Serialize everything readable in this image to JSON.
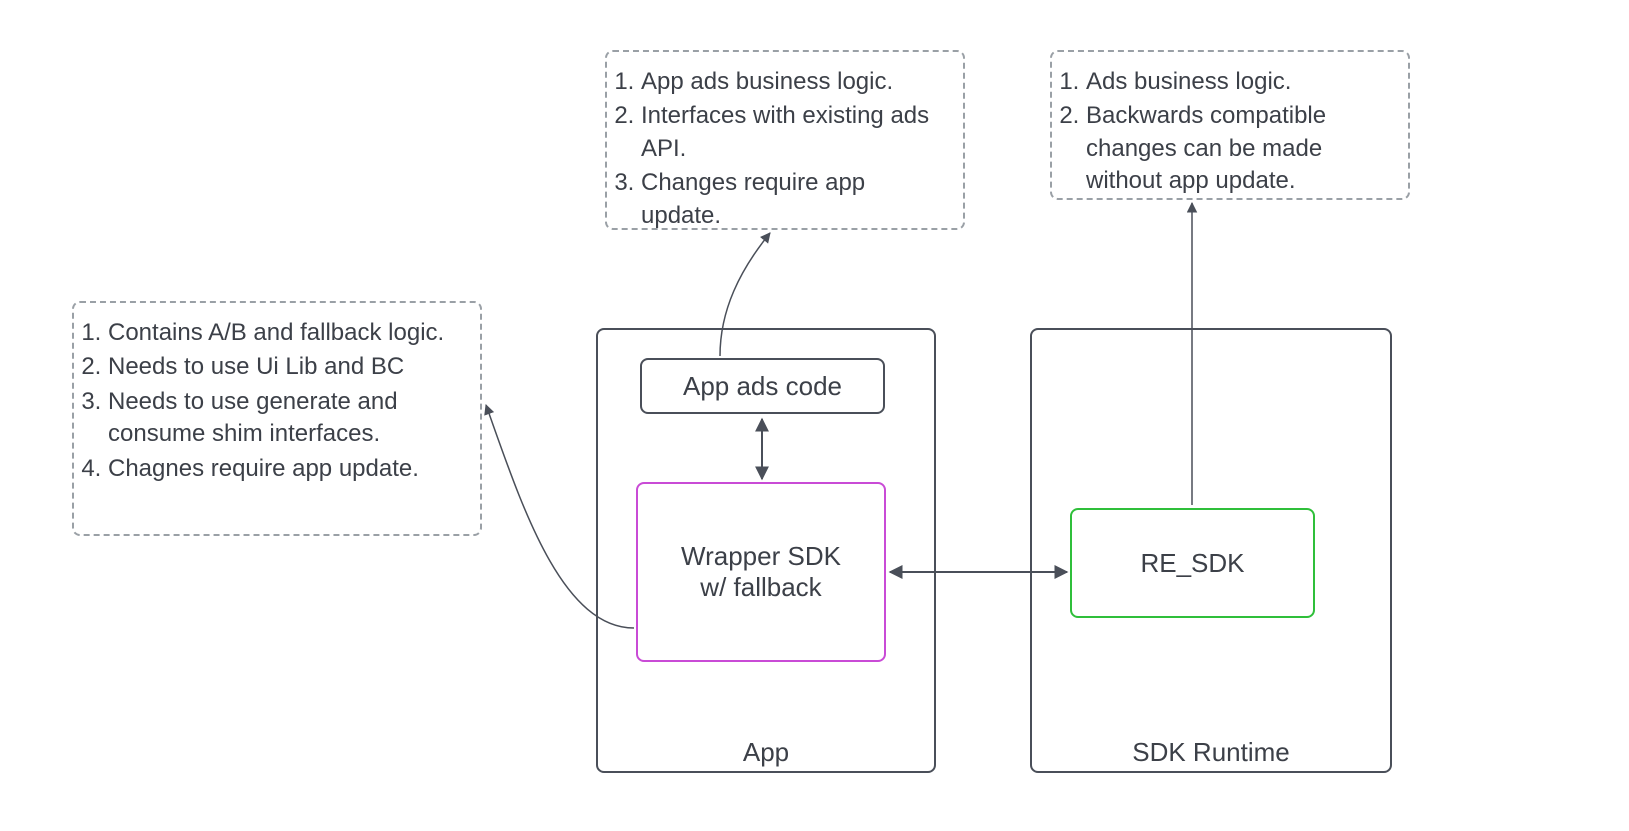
{
  "notes": {
    "left": {
      "items": [
        "Contains A/B and fallback logic.",
        "Needs to use Ui Lib and BC",
        "Needs to use generate and consume shim interfaces.",
        "Chagnes require app update."
      ]
    },
    "top_center": {
      "items": [
        "App ads business logic.",
        "Interfaces with existing ads API.",
        "Changes require app update."
      ]
    },
    "top_right": {
      "items": [
        "Ads business logic.",
        "Backwards compatible changes can be made without app update."
      ]
    }
  },
  "containers": {
    "app": {
      "title": "App"
    },
    "sdk_runtime": {
      "title": "SDK Runtime"
    }
  },
  "nodes": {
    "app_ads_code": {
      "label": "App ads code"
    },
    "wrapper_sdk": {
      "line1": "Wrapper SDK",
      "line2": "w/ fallback"
    },
    "re_sdk": {
      "label": "RE_SDK"
    }
  },
  "colors": {
    "border": "#4a4f59",
    "note_border": "#9aa0a6",
    "wrapper_border": "#c94bd6",
    "re_sdk_border": "#2fbf3a",
    "text": "#3c4048"
  }
}
